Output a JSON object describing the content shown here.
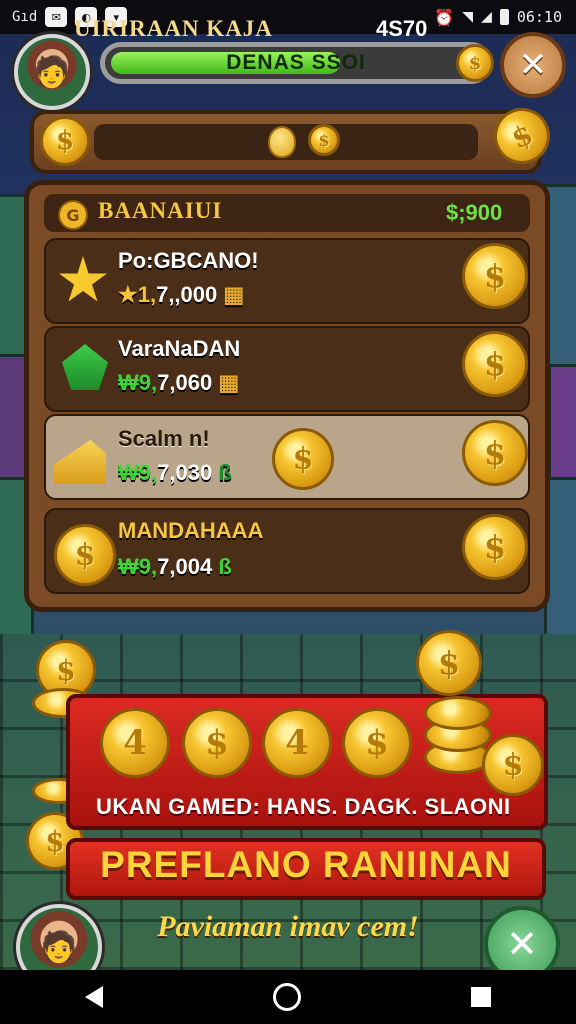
{
  "status_bar": {
    "carrier": "Gıd",
    "time": "06:10"
  },
  "hud": {
    "progress_label": "DENAS SSOI",
    "progress_fraction": 0.62
  },
  "currency_banner": {
    "label": "UIRIRAAN KAJA",
    "amount": "4S70"
  },
  "panel": {
    "title": "BAANAIUI",
    "total": "$;900",
    "items": [
      {
        "name": "Po:GBCANO!",
        "price_prefix": "★1,",
        "price_value": "7,,000",
        "icon": "star-icon"
      },
      {
        "name": "VaraNaDAN",
        "price_prefix": "₩9,",
        "price_value": "7,060",
        "icon": "badge-icon"
      },
      {
        "name": "Scalm n!",
        "price_prefix": "₩9,",
        "price_value": "7,030",
        "icon": "ticket-icon"
      },
      {
        "name": "MANDAHAAA",
        "price_prefix": "₩9,",
        "price_value": "7,004",
        "icon": "coin-icon"
      }
    ]
  },
  "offer": {
    "coin_faces": [
      "4",
      "$",
      "4",
      "$"
    ],
    "caption": "UKAN GAMED: HANS. DAGK. SLAONI",
    "cta_label": "PREFLANO RANIINAN",
    "tagline": "Paviaman imav cem!"
  },
  "colors": {
    "accent_gold": "#f7c531",
    "price_green": "#3ed43a",
    "cta_red": "#dc2a22",
    "progress_green": "#3fb819"
  }
}
